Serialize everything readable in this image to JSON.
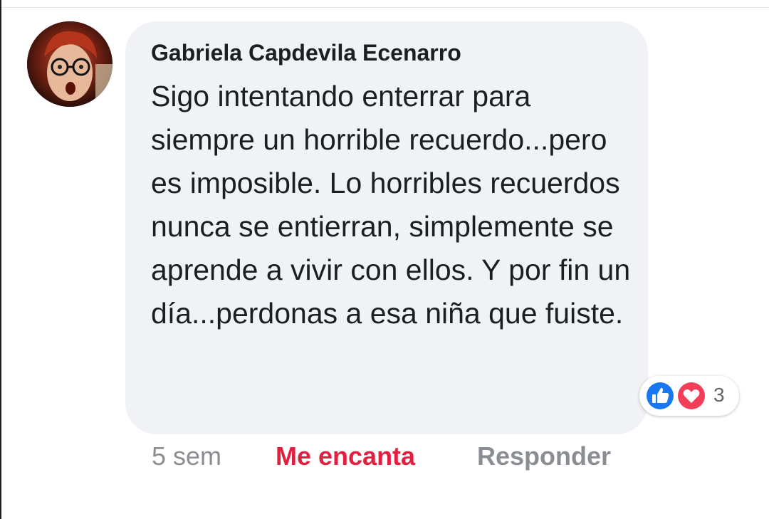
{
  "comment": {
    "author": "Gabriela Capdevila Ecenarro",
    "text": "Sigo intentando enterrar para siempre un horrible recuerdo...pero es imposible. Lo horribles recuerdos nunca se entierran, simplemente se aprende a vivir con ellos. Y por fin un día...perdonas a esa niña que fuiste.",
    "timestamp": "5 sem",
    "reactions": {
      "icons": [
        "like-icon",
        "love-icon"
      ],
      "count": "3"
    }
  },
  "actions": {
    "reacted_label": "Me encanta",
    "reply_label": "Responder"
  },
  "colors": {
    "bubble": "#f0f2f5",
    "reacted": "#e41e3f",
    "like_blue": "#1877f2",
    "love_red": "#f33e58"
  }
}
